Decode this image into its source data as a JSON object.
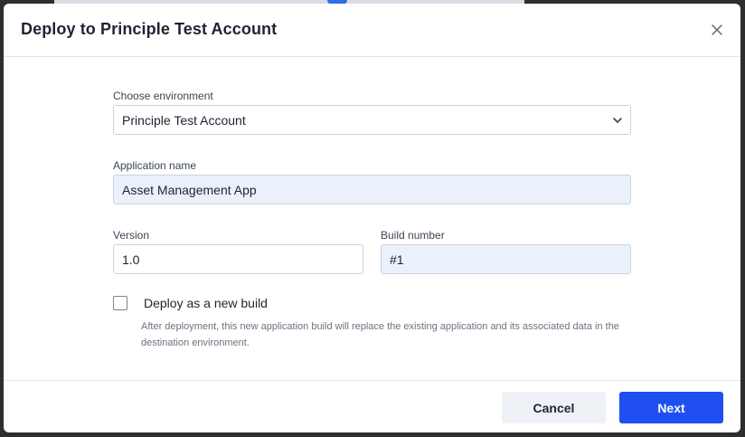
{
  "modal": {
    "title": "Deploy to Principle Test Account"
  },
  "form": {
    "environment_label": "Choose environment",
    "environment_value": "Principle Test Account",
    "app_name_label": "Application name",
    "app_name_value": "Asset Management App",
    "version_label": "Version",
    "version_value": "1.0",
    "build_label": "Build number",
    "build_value": "#1",
    "new_build_label": "Deploy as a new build",
    "new_build_checked": false,
    "new_build_help": "After deployment, this new application build will replace the existing application and its associated data in the destination environment."
  },
  "footer": {
    "cancel_label": "Cancel",
    "next_label": "Next"
  },
  "colors": {
    "primary": "#1f4ff0",
    "readonly_bg": "#eaf1fb"
  },
  "icons": {
    "close": "close-icon",
    "dropdown": "chevron-down-icon"
  }
}
